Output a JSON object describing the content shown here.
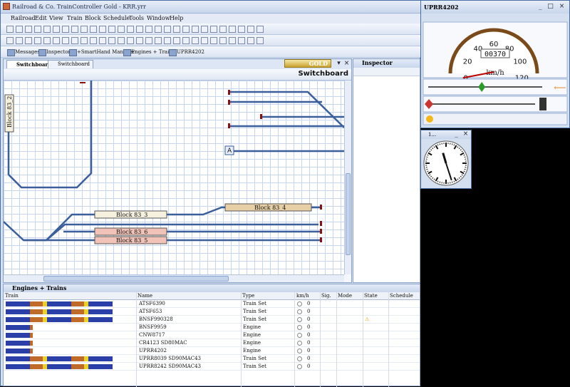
{
  "app": {
    "title": "Railroad & Co. TrainController Gold - KRR.yrr"
  },
  "menu": [
    "Railroad",
    "Edit",
    "View",
    "Train",
    "Block",
    "Schedule",
    "Tools",
    "Window",
    "Help"
  ],
  "toolbar_tabs": [
    "Messages",
    "Inspector",
    "+SmartHand Manager",
    "Engines + Trains",
    "UPRR4202"
  ],
  "switchboard": {
    "tabs": [
      "Switchboard",
      "Switchboard"
    ],
    "badge": "GOLD",
    "title": "Switchboard",
    "blocks": [
      "Block 83_2",
      "Block 83_3",
      "Block 83_4",
      "Block 83_6",
      "Block 83_5"
    ],
    "marker": "A"
  },
  "inspector": {
    "title": "Inspector"
  },
  "engines_panel": {
    "title": "Engines + Trains",
    "columns": [
      "Train",
      "Name",
      "Type",
      "km/h",
      "Sig.",
      "Mode",
      "State",
      "Schedule"
    ],
    "rows": [
      {
        "name": "ATSF6390",
        "type": "Train Set",
        "speed": "0",
        "warning": false
      },
      {
        "name": "ATSF653",
        "type": "Train Set",
        "speed": "0",
        "warning": false
      },
      {
        "name": "BNSF990328",
        "type": "Train Set",
        "speed": "0",
        "warning": true
      },
      {
        "name": "BNSF9959",
        "type": "Engine",
        "speed": "0",
        "warning": false
      },
      {
        "name": "CNW8717",
        "type": "Engine",
        "speed": "0",
        "warning": false
      },
      {
        "name": "CR4123 SD80MAC",
        "type": "Engine",
        "speed": "0",
        "warning": false
      },
      {
        "name": "UPRR4202",
        "type": "Engine",
        "speed": "0",
        "warning": false
      },
      {
        "name": "UPRR8039 SD90MAC43",
        "type": "Train Set",
        "speed": "0",
        "warning": false
      },
      {
        "name": "UPRR8242 SD90MAC43",
        "type": "Train Set",
        "speed": "0",
        "warning": false
      }
    ]
  },
  "cab": {
    "title": "UPRR4202",
    "unit": "km/h",
    "odometer": "00370",
    "speed": 0,
    "scale": [
      "0",
      "20",
      "40",
      "60",
      "80",
      "100",
      "120"
    ],
    "throttle_fraction": 0.47
  },
  "clock": {
    "title": "1...",
    "hour": 11,
    "minute": 27
  }
}
